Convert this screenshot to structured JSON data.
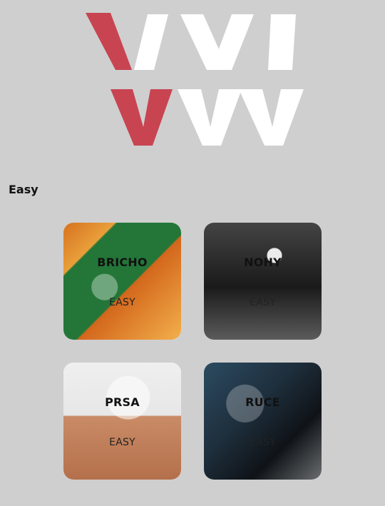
{
  "section": {
    "title": "Easy"
  },
  "cards": [
    {
      "title": "BRICHO",
      "level": "EASY",
      "image_icon": "beer-pack-photo"
    },
    {
      "title": "NOHY",
      "level": "EASY",
      "image_icon": "legs-workout-photo"
    },
    {
      "title": "PRSA",
      "level": "EASY",
      "image_icon": "chest-muscles-photo"
    },
    {
      "title": "RUCE",
      "level": "EASY",
      "image_icon": "arms-workout-photo"
    }
  ],
  "colors": {
    "background": "#cfcfcf",
    "logo_red": "#c84451",
    "logo_white": "#ffffff"
  }
}
